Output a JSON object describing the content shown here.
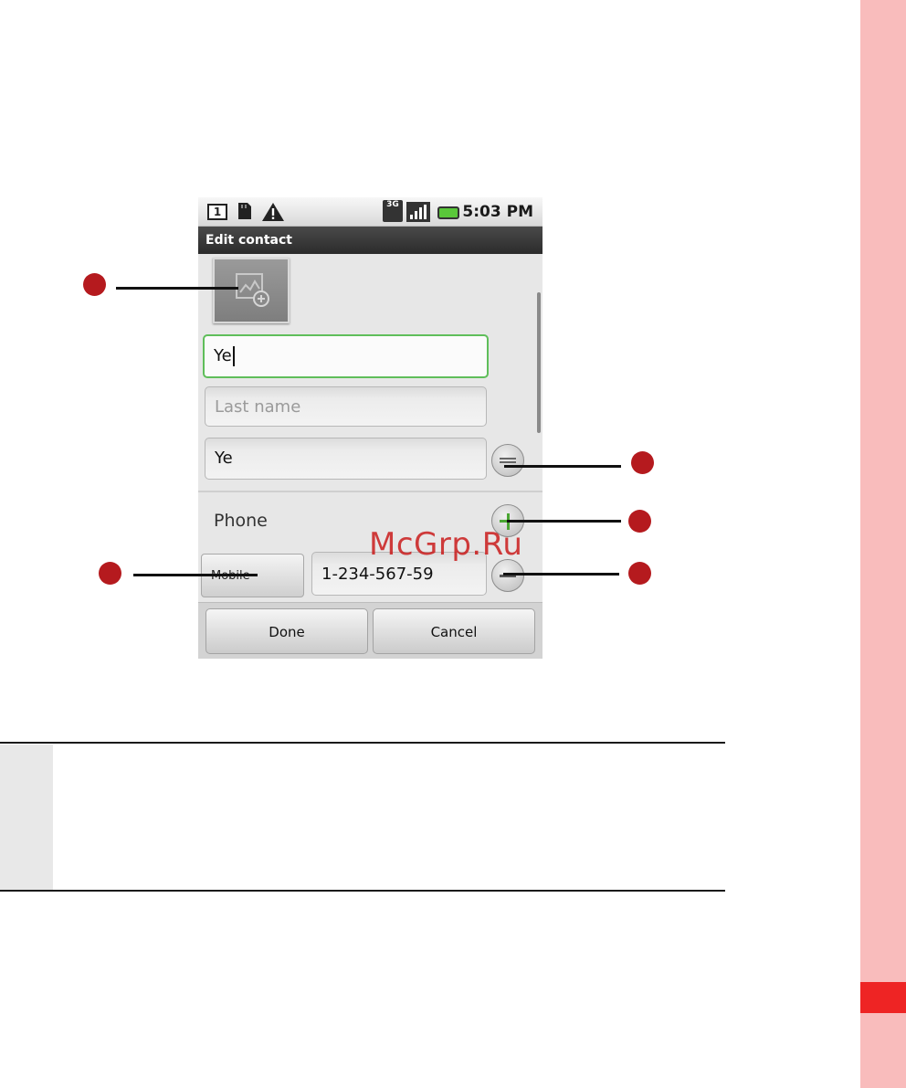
{
  "statusbar": {
    "sim_number": "1",
    "network_type": "3G",
    "time": "5:03 PM"
  },
  "titlebar": {
    "title": "Edit contact"
  },
  "form": {
    "first_name_value": "Ye",
    "last_name_placeholder": "Last name",
    "display_name_value": "Ye",
    "phone_label": "Phone",
    "phone_type": "Mobile",
    "phone_number": "1-234-567-59"
  },
  "buttons": {
    "done": "Done",
    "cancel": "Cancel"
  },
  "watermark": "McGrp.Ru",
  "colors": {
    "side_strip": "#f9bcbc",
    "side_tab": "#ee2424",
    "callout_dot": "#b51a1e",
    "focus_border": "#5fbe5a",
    "battery": "#5ac83a",
    "add_icon": "#4aa632"
  },
  "icons": {
    "photo": "image-add-icon",
    "expand": "expand-name-icon",
    "add": "add-field-icon",
    "remove": "remove-field-icon",
    "sim": "sim-icon",
    "sdcard": "sd-card-icon",
    "warning": "warning-icon",
    "signal": "signal-icon",
    "battery": "battery-icon"
  }
}
